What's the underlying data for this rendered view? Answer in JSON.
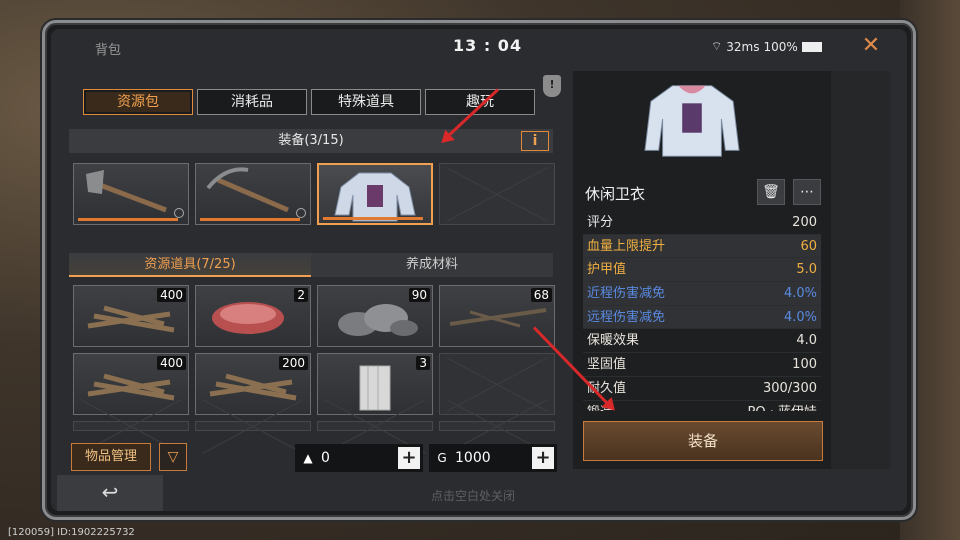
{
  "header": {
    "title": "背包",
    "clock": "13 : 04",
    "latency": "32ms",
    "battery": "100%",
    "close_icon": "close-icon"
  },
  "tabs": [
    {
      "label": "资源包"
    },
    {
      "label": "消耗品"
    },
    {
      "label": "特殊道具"
    },
    {
      "label": "趣玩"
    }
  ],
  "equip_section": {
    "label": "装备(3/15)",
    "info": "i"
  },
  "equip_slots": [
    {
      "item": "axe"
    },
    {
      "item": "pickaxe"
    },
    {
      "item": "jacket",
      "selected": true
    },
    {
      "item": "empty"
    }
  ],
  "subtabs": [
    {
      "label": "资源道具(7/25)"
    },
    {
      "label": "养成材料"
    }
  ],
  "resource_items": [
    {
      "item": "logs",
      "count": "400"
    },
    {
      "item": "meat",
      "count": "2"
    },
    {
      "item": "stones",
      "count": "90"
    },
    {
      "item": "spikes",
      "count": "68"
    },
    {
      "item": "logs",
      "count": "400"
    },
    {
      "item": "logs",
      "count": "200"
    },
    {
      "item": "fence",
      "count": "3"
    },
    {
      "item": "empty",
      "count": ""
    }
  ],
  "bottom": {
    "manage_label": "物品管理",
    "filter_icon": "filter-icon",
    "currency1": "0",
    "currency2": "1000"
  },
  "detail": {
    "name": "休闲卫衣",
    "stats": [
      {
        "label": "评分",
        "value": "200",
        "color": "#e8e8e8"
      },
      {
        "label": "血量上限提升",
        "value": "60",
        "color": "#f0b040"
      },
      {
        "label": "护甲值",
        "value": "5.0",
        "color": "#f0b040"
      },
      {
        "label": "近程伤害减免",
        "value": "4.0%",
        "color": "#5a8ae0"
      },
      {
        "label": "远程伤害减免",
        "value": "4.0%",
        "color": "#5a8ae0"
      },
      {
        "label": "保暖效果",
        "value": "4.0",
        "color": "#e8e8e8"
      },
      {
        "label": "坚固值",
        "value": "100",
        "color": "#e8e8e8"
      },
      {
        "label": "耐久值",
        "value": "300/300",
        "color": "#e8e8e8"
      },
      {
        "label": "锻造",
        "value": "PO · 蓝伊娃",
        "color": "#e8e8e8"
      }
    ],
    "equip_label": "装备"
  },
  "hint": "点击空白处关闭",
  "footer": "[120059] ID:1902225732"
}
